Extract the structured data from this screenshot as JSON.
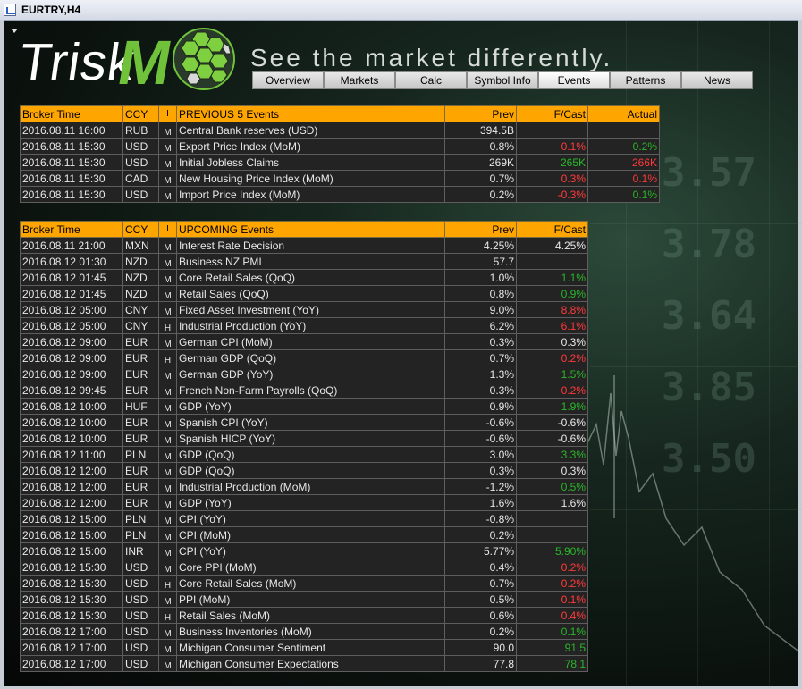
{
  "window": {
    "title": "EURTRY,H4"
  },
  "logo": {
    "text": "Trisk",
    "m": "M"
  },
  "tagline": "See  the  market  differently.",
  "tabs": [
    "Overview",
    "Markets",
    "Calc",
    "Symbol Info",
    "Events",
    "Patterns",
    "News"
  ],
  "active_tab": "Events",
  "background_text": [
    "3.57",
    "3.78",
    "3.64",
    "3.85",
    "3.50"
  ],
  "previous": {
    "headers": {
      "time": "Broker Time",
      "ccy": "CCY",
      "imp": "I",
      "event": "PREVIOUS 5 Events",
      "prev": "Prev",
      "fcast": "F/Cast",
      "actual": "Actual"
    },
    "rows": [
      {
        "time": "2016.08.11 16:00",
        "ccy": "RUB",
        "imp": "M",
        "event": "Central Bank reserves (USD)",
        "prev": "394.5B",
        "fcast": "",
        "fcast_color": "white",
        "actual": "",
        "actual_color": "white"
      },
      {
        "time": "2016.08.11 15:30",
        "ccy": "USD",
        "imp": "M",
        "event": "Export Price Index (MoM)",
        "prev": "0.8%",
        "fcast": "0.1%",
        "fcast_color": "red",
        "actual": "0.2%",
        "actual_color": "green"
      },
      {
        "time": "2016.08.11 15:30",
        "ccy": "USD",
        "imp": "M",
        "event": "Initial Jobless Claims",
        "prev": "269K",
        "fcast": "265K",
        "fcast_color": "green",
        "actual": "266K",
        "actual_color": "red"
      },
      {
        "time": "2016.08.11 15:30",
        "ccy": "CAD",
        "imp": "M",
        "event": "New Housing Price Index (MoM)",
        "prev": "0.7%",
        "fcast": "0.3%",
        "fcast_color": "red",
        "actual": "0.1%",
        "actual_color": "red"
      },
      {
        "time": "2016.08.11 15:30",
        "ccy": "USD",
        "imp": "M",
        "event": "Import Price Index (MoM)",
        "prev": "0.2%",
        "fcast": "-0.3%",
        "fcast_color": "red",
        "actual": "0.1%",
        "actual_color": "green"
      }
    ]
  },
  "upcoming": {
    "headers": {
      "time": "Broker Time",
      "ccy": "CCY",
      "imp": "I",
      "event": "UPCOMING Events",
      "prev": "Prev",
      "fcast": "F/Cast"
    },
    "rows": [
      {
        "time": "2016.08.11 21:00",
        "ccy": "MXN",
        "imp": "M",
        "event": "Interest Rate Decision",
        "prev": "4.25%",
        "fcast": "4.25%",
        "fcast_color": "white"
      },
      {
        "time": "2016.08.12 01:30",
        "ccy": "NZD",
        "imp": "M",
        "event": "Business NZ PMI",
        "prev": "57.7",
        "fcast": "",
        "fcast_color": "white"
      },
      {
        "time": "2016.08.12 01:45",
        "ccy": "NZD",
        "imp": "M",
        "event": "Core Retail Sales (QoQ)",
        "prev": "1.0%",
        "fcast": "1.1%",
        "fcast_color": "green"
      },
      {
        "time": "2016.08.12 01:45",
        "ccy": "NZD",
        "imp": "M",
        "event": "Retail Sales (QoQ)",
        "prev": "0.8%",
        "fcast": "0.9%",
        "fcast_color": "green"
      },
      {
        "time": "2016.08.12 05:00",
        "ccy": "CNY",
        "imp": "M",
        "event": "Fixed Asset Investment (YoY)",
        "prev": "9.0%",
        "fcast": "8.8%",
        "fcast_color": "red"
      },
      {
        "time": "2016.08.12 05:00",
        "ccy": "CNY",
        "imp": "H",
        "event": "Industrial Production (YoY)",
        "prev": "6.2%",
        "fcast": "6.1%",
        "fcast_color": "red"
      },
      {
        "time": "2016.08.12 09:00",
        "ccy": "EUR",
        "imp": "M",
        "event": "German CPI (MoM)",
        "prev": "0.3%",
        "fcast": "0.3%",
        "fcast_color": "white"
      },
      {
        "time": "2016.08.12 09:00",
        "ccy": "EUR",
        "imp": "H",
        "event": "German GDP (QoQ)",
        "prev": "0.7%",
        "fcast": "0.2%",
        "fcast_color": "red"
      },
      {
        "time": "2016.08.12 09:00",
        "ccy": "EUR",
        "imp": "M",
        "event": "German GDP (YoY)",
        "prev": "1.3%",
        "fcast": "1.5%",
        "fcast_color": "green"
      },
      {
        "time": "2016.08.12 09:45",
        "ccy": "EUR",
        "imp": "M",
        "event": "French Non-Farm Payrolls (QoQ)",
        "prev": "0.3%",
        "fcast": "0.2%",
        "fcast_color": "red"
      },
      {
        "time": "2016.08.12 10:00",
        "ccy": "HUF",
        "imp": "M",
        "event": "GDP (YoY)",
        "prev": "0.9%",
        "fcast": "1.9%",
        "fcast_color": "green"
      },
      {
        "time": "2016.08.12 10:00",
        "ccy": "EUR",
        "imp": "M",
        "event": "Spanish CPI (YoY)",
        "prev": "-0.6%",
        "fcast": "-0.6%",
        "fcast_color": "white"
      },
      {
        "time": "2016.08.12 10:00",
        "ccy": "EUR",
        "imp": "M",
        "event": "Spanish HICP (YoY)",
        "prev": "-0.6%",
        "fcast": "-0.6%",
        "fcast_color": "white"
      },
      {
        "time": "2016.08.12 11:00",
        "ccy": "PLN",
        "imp": "M",
        "event": "GDP (QoQ)",
        "prev": "3.0%",
        "fcast": "3.3%",
        "fcast_color": "green"
      },
      {
        "time": "2016.08.12 12:00",
        "ccy": "EUR",
        "imp": "M",
        "event": "GDP (QoQ)",
        "prev": "0.3%",
        "fcast": "0.3%",
        "fcast_color": "white"
      },
      {
        "time": "2016.08.12 12:00",
        "ccy": "EUR",
        "imp": "M",
        "event": "Industrial Production (MoM)",
        "prev": "-1.2%",
        "fcast": "0.5%",
        "fcast_color": "green"
      },
      {
        "time": "2016.08.12 12:00",
        "ccy": "EUR",
        "imp": "M",
        "event": "GDP (YoY)",
        "prev": "1.6%",
        "fcast": "1.6%",
        "fcast_color": "white"
      },
      {
        "time": "2016.08.12 15:00",
        "ccy": "PLN",
        "imp": "M",
        "event": "CPI (YoY)",
        "prev": "-0.8%",
        "fcast": "",
        "fcast_color": "white"
      },
      {
        "time": "2016.08.12 15:00",
        "ccy": "PLN",
        "imp": "M",
        "event": "CPI (MoM)",
        "prev": "0.2%",
        "fcast": "",
        "fcast_color": "white"
      },
      {
        "time": "2016.08.12 15:00",
        "ccy": "INR",
        "imp": "M",
        "event": "CPI (YoY)",
        "prev": "5.77%",
        "fcast": "5.90%",
        "fcast_color": "green"
      },
      {
        "time": "2016.08.12 15:30",
        "ccy": "USD",
        "imp": "M",
        "event": "Core PPI (MoM)",
        "prev": "0.4%",
        "fcast": "0.2%",
        "fcast_color": "red"
      },
      {
        "time": "2016.08.12 15:30",
        "ccy": "USD",
        "imp": "H",
        "event": "Core Retail Sales (MoM)",
        "prev": "0.7%",
        "fcast": "0.2%",
        "fcast_color": "red"
      },
      {
        "time": "2016.08.12 15:30",
        "ccy": "USD",
        "imp": "M",
        "event": "PPI (MoM)",
        "prev": "0.5%",
        "fcast": "0.1%",
        "fcast_color": "red"
      },
      {
        "time": "2016.08.12 15:30",
        "ccy": "USD",
        "imp": "H",
        "event": "Retail Sales (MoM)",
        "prev": "0.6%",
        "fcast": "0.4%",
        "fcast_color": "red"
      },
      {
        "time": "2016.08.12 17:00",
        "ccy": "USD",
        "imp": "M",
        "event": "Business Inventories (MoM)",
        "prev": "0.2%",
        "fcast": "0.1%",
        "fcast_color": "green"
      },
      {
        "time": "2016.08.12 17:00",
        "ccy": "USD",
        "imp": "M",
        "event": "Michigan Consumer Sentiment",
        "prev": "90.0",
        "fcast": "91.5",
        "fcast_color": "green"
      },
      {
        "time": "2016.08.12 17:00",
        "ccy": "USD",
        "imp": "M",
        "event": "Michigan Consumer Expectations",
        "prev": "77.8",
        "fcast": "78.1",
        "fcast_color": "green"
      }
    ]
  },
  "colors": {
    "header_bg": "#ffa500",
    "cell_bg": "#232323",
    "red": "#ff3a3a",
    "green": "#29b729",
    "logo_green": "#6fc23a"
  }
}
